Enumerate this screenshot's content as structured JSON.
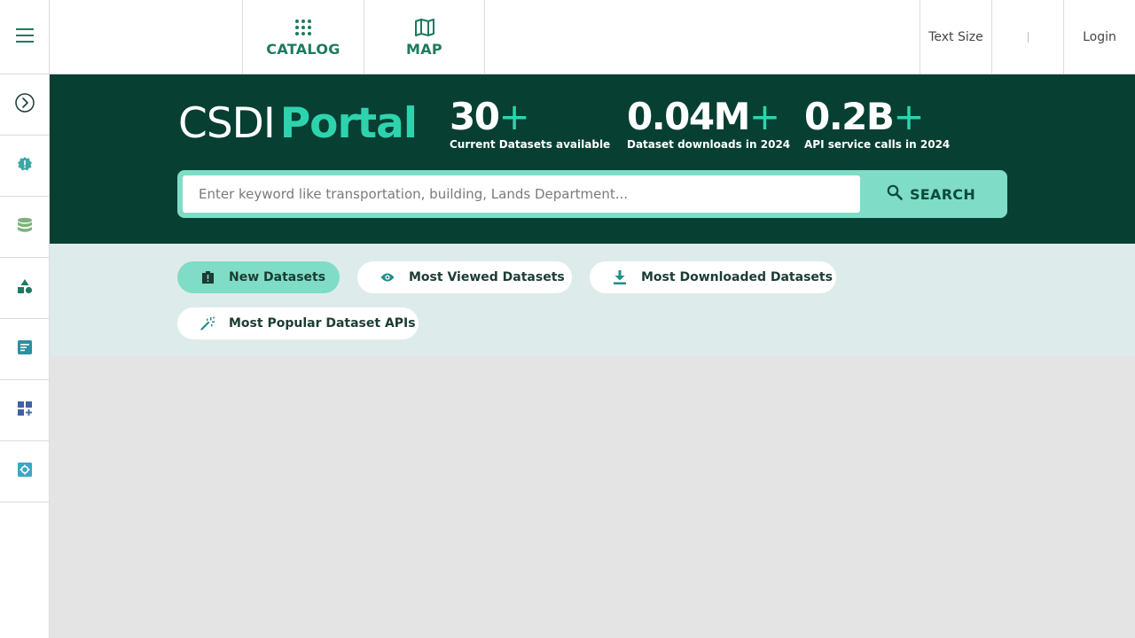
{
  "topbar": {
    "menu_icon": "hamburger-menu-icon",
    "tabs": [
      {
        "label": "CATALOG",
        "icon": "grid-dots-icon"
      },
      {
        "label": "MAP",
        "icon": "folded-map-icon"
      }
    ],
    "text_size_label": "Text Size",
    "login_label": "Login"
  },
  "sidebar": {
    "items": [
      {
        "icon": "chevron-right-circle-icon"
      },
      {
        "icon": "alert-badge-icon"
      },
      {
        "icon": "database-stack-icon"
      },
      {
        "icon": "shapes-icon"
      },
      {
        "icon": "document-lines-icon"
      },
      {
        "icon": "dashboard-add-icon"
      },
      {
        "icon": "settings-gear-icon"
      }
    ]
  },
  "hero": {
    "brand_main": "CSDI",
    "brand_accent": "Portal",
    "stats": [
      {
        "value": "30",
        "suffix": "+",
        "label": "Current Datasets available"
      },
      {
        "value": "0.04M",
        "suffix": "+",
        "label": "Dataset downloads in 2024"
      },
      {
        "value": "0.2B",
        "suffix": "+",
        "label": "API service calls in 2024"
      }
    ],
    "search": {
      "placeholder": "Enter keyword like transportation, building, Lands Department...",
      "value": "",
      "button_label": "SEARCH"
    }
  },
  "filters": {
    "chips": [
      {
        "label": "New Datasets",
        "icon": "new-badge-icon",
        "active": true
      },
      {
        "label": "Most Viewed Datasets",
        "icon": "eye-icon",
        "active": false
      },
      {
        "label": "Most Downloaded Datasets",
        "icon": "download-icon",
        "active": false
      },
      {
        "label": "Most Popular Dataset APIs",
        "icon": "sparkle-wand-icon",
        "active": false
      }
    ]
  },
  "colors": {
    "hero_bg": "#073f33",
    "accent": "#2ed3ae",
    "mint": "#7fdcc6",
    "brand_green": "#1d7a5f",
    "filter_bg": "#ddecea",
    "content_bg": "#e4e4e4"
  }
}
